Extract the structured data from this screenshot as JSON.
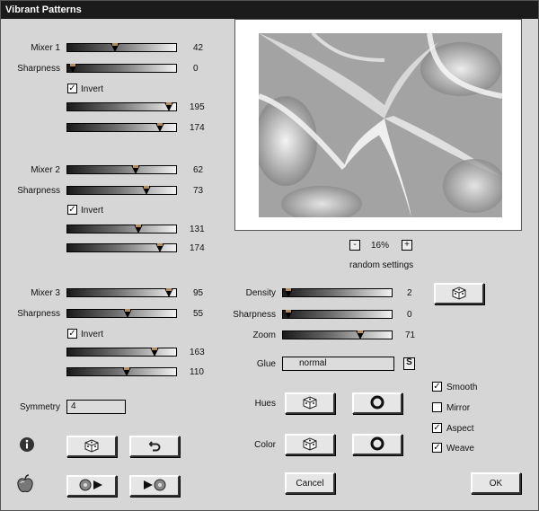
{
  "window": {
    "title": "Vibrant Patterns"
  },
  "group1": {
    "mixer_label": "Mixer 1",
    "mixer_value": "42",
    "sharpness_label": "Sharpness",
    "sharpness_value": "0",
    "invert_label": "Invert",
    "invert_checked": true,
    "s1_value": "195",
    "s2_value": "174"
  },
  "group2": {
    "mixer_label": "Mixer 2",
    "mixer_value": "62",
    "sharpness_label": "Sharpness",
    "sharpness_value": "73",
    "invert_label": "Invert",
    "invert_checked": true,
    "s1_value": "131",
    "s2_value": "174"
  },
  "group3": {
    "mixer_label": "Mixer 3",
    "mixer_value": "95",
    "sharpness_label": "Sharpness",
    "sharpness_value": "55",
    "invert_label": "Invert",
    "invert_checked": true,
    "s1_value": "163",
    "s2_value": "110"
  },
  "symmetry": {
    "label": "Symmetry",
    "value": "4"
  },
  "zoom_bar": {
    "minus": "-",
    "zoom": "16%",
    "plus": "+"
  },
  "random_settings_label": "random settings",
  "right": {
    "density_label": "Density",
    "density_value": "2",
    "sharpness_label": "Sharpness",
    "sharpness_value": "0",
    "zoom_label": "Zoom",
    "zoom_value": "71",
    "glue_label": "Glue",
    "glue_value": "normal",
    "glue_button": "S",
    "hues_label": "Hues",
    "color_label": "Color"
  },
  "options": {
    "smooth": {
      "label": "Smooth",
      "checked": true
    },
    "mirror": {
      "label": "Mirror",
      "checked": false
    },
    "aspect": {
      "label": "Aspect",
      "checked": true
    },
    "weave": {
      "label": "Weave",
      "checked": true
    }
  },
  "buttons": {
    "cancel": "Cancel",
    "ok": "OK"
  },
  "icons": {
    "info": "info-icon",
    "dice": "dice-icon",
    "undo": "undo-icon",
    "ring": "ring-icon",
    "play_back": "play-back-icon",
    "play_fwd": "play-forward-icon",
    "apple": "apple-icon"
  }
}
